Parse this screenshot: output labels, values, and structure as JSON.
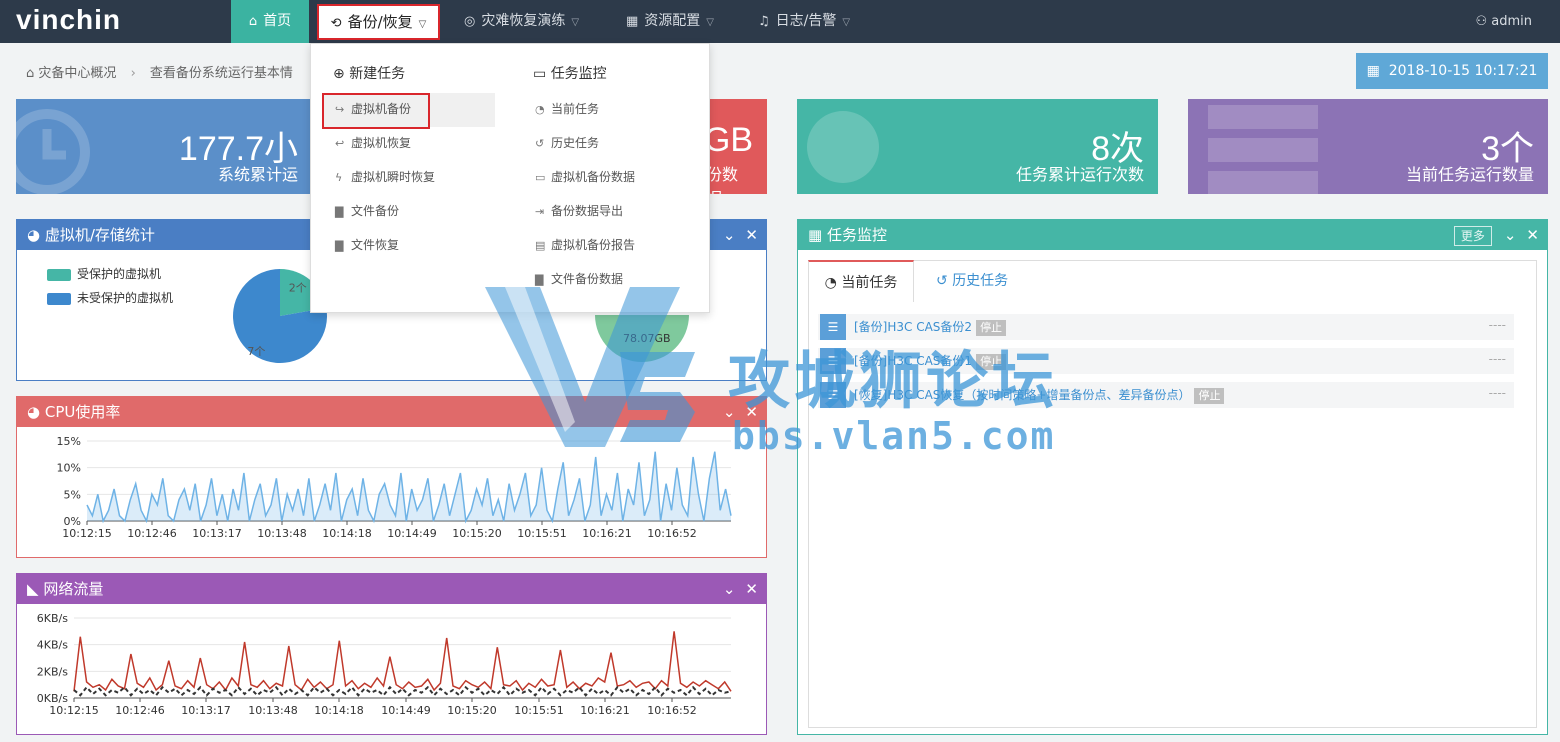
{
  "nav": {
    "logo": "vinchin",
    "items": [
      {
        "label": "首页"
      },
      {
        "label": "备份/恢复"
      },
      {
        "label": "灾难恢复演练"
      },
      {
        "label": "资源配置"
      },
      {
        "label": "日志/告警"
      }
    ],
    "user": "admin"
  },
  "breadcrumb": {
    "home": "灾备中心概况",
    "current": "查看备份系统运行基本情"
  },
  "datetime": "2018-10-15 10:17:21",
  "stats": [
    {
      "value": "177.7小",
      "label": "系统累计运"
    },
    {
      "value": "GB",
      "label": "份数据"
    },
    {
      "value": "8次",
      "label": "任务累计运行次数"
    },
    {
      "value": "3个",
      "label": "当前任务运行数量"
    }
  ],
  "dropdown": {
    "col1_title": "新建任务",
    "col1_items": [
      "虚拟机备份",
      "虚拟机恢复",
      "虚拟机瞬时恢复",
      "文件备份",
      "文件恢复"
    ],
    "col2_title": "任务监控",
    "col2_items": [
      "当前任务",
      "历史任务",
      "虚拟机备份数据",
      "备份数据导出",
      "虚拟机备份报告",
      "文件备份数据"
    ]
  },
  "panels": {
    "vm_title": "虚拟机/存储统计",
    "cpu_title": "CPU使用率",
    "net_title": "网络流量",
    "task_title": "任务监控",
    "task_more": "更多"
  },
  "vm_legend": [
    "受保护的虚拟机",
    "未受保护的虚拟机"
  ],
  "pie_labels": {
    "protected": "2个",
    "unprotected": "7个",
    "storage": "78.07GB"
  },
  "task_tabs": {
    "current": "当前任务",
    "history": "历史任务"
  },
  "tasks": [
    {
      "name": "[备份]H3C CAS备份2",
      "status": "停止",
      "time": "----"
    },
    {
      "name": "[备份]H3C CAS备份1",
      "status": "停止",
      "time": "----"
    },
    {
      "name": "[恢复]H3C CAS恢复（按时间策略+增量备份点、差异备份点）",
      "status": "停止",
      "time": "----"
    }
  ],
  "watermark": {
    "text": "攻城狮论坛",
    "url": "bbs.vlan5.com"
  },
  "colors": {
    "nav_bg": "#2d3a4a",
    "accent": "#3bb3a1",
    "blue": "#5b8fc9",
    "red": "#e0595b",
    "teal": "#45b6a6",
    "purple": "#8c73b5"
  },
  "chart_data": [
    {
      "type": "pie",
      "labels": [
        "受保护的虚拟机",
        "未受保护的虚拟机"
      ],
      "values": [
        2,
        7
      ]
    },
    {
      "type": "area",
      "title": "CPU使用率",
      "x": [
        "10:12:15",
        "10:12:46",
        "10:13:17",
        "10:13:48",
        "10:14:18",
        "10:14:49",
        "10:15:20",
        "10:15:51",
        "10:16:21",
        "10:16:52"
      ],
      "yticks": [
        "15%",
        "10%",
        "5%",
        "0%"
      ],
      "ylim": [
        0,
        15
      ],
      "series": [
        {
          "values": [
            3,
            1,
            5,
            0,
            2,
            6,
            1,
            0,
            4,
            7,
            2,
            0,
            5,
            3,
            8,
            1,
            0,
            4,
            6,
            2,
            7,
            0,
            3,
            8,
            1,
            5,
            0,
            6,
            2,
            9,
            0,
            4,
            7,
            1,
            3,
            8,
            0,
            5,
            2,
            6,
            1,
            8,
            0,
            3,
            7,
            2,
            9,
            0,
            4,
            6,
            1,
            8,
            2,
            0,
            5,
            7,
            3,
            1,
            9,
            0,
            6,
            2,
            4,
            8,
            0,
            3,
            7,
            1,
            5,
            9,
            0,
            2,
            6,
            3,
            8,
            1,
            4,
            0,
            7,
            2,
            5,
            9,
            1,
            3,
            10,
            2,
            0,
            6,
            11,
            1,
            4,
            8,
            0,
            3,
            12,
            1,
            5,
            2,
            9,
            0,
            6,
            3,
            11,
            1,
            4,
            13,
            0,
            7,
            2,
            10,
            3,
            1,
            12,
            5,
            0,
            8,
            13,
            2,
            6,
            1
          ]
        }
      ]
    },
    {
      "type": "line",
      "title": "网络流量",
      "x": [
        "10:12:15",
        "10:12:46",
        "10:13:17",
        "10:13:48",
        "10:14:18",
        "10:14:49",
        "10:15:20",
        "10:15:51",
        "10:16:21",
        "10:16:52"
      ],
      "yticks": [
        "6KB/s",
        "4KB/s",
        "2KB/s",
        "0KB/s"
      ],
      "ylim": [
        0,
        6
      ],
      "series": [
        {
          "values": [
            0.5,
            4.6,
            1.2,
            0.8,
            1.0,
            0.6,
            1.4,
            0.9,
            0.7,
            3.3,
            1.1,
            0.8,
            1.5,
            0.6,
            1.0,
            2.8,
            0.9,
            0.7,
            1.3,
            0.8,
            3.0,
            1.0,
            0.7,
            1.2,
            0.6,
            1.5,
            0.9,
            4.2,
            1.0,
            0.8,
            1.3,
            0.7,
            1.1,
            0.9,
            3.9,
            1.0,
            0.6,
            1.4,
            0.8,
            1.2,
            0.7,
            1.0,
            4.3,
            0.9,
            1.3,
            0.7,
            1.1,
            0.8,
            1.5,
            0.9,
            3.1,
            1.0,
            0.7,
            1.2,
            0.8,
            0.9,
            1.4,
            0.6,
            1.1,
            4.5,
            0.9,
            0.7,
            1.3,
            1.0,
            0.8,
            1.2,
            0.7,
            3.8,
            1.0,
            0.9,
            1.3,
            0.6,
            1.1,
            0.8,
            1.4,
            0.9,
            1.0,
            3.6,
            0.8,
            1.2,
            0.7,
            1.1,
            0.9,
            1.5,
            1.2,
            3.4,
            0.9,
            1.0,
            1.3,
            0.8,
            1.1,
            1.2,
            0.7,
            1.3,
            0.9,
            5.0,
            1.1,
            0.8,
            1.2,
            0.9,
            1.3,
            1.0,
            0.7,
            1.2,
            0.5
          ]
        },
        {
          "values": [
            0.6,
            0.2,
            0.8,
            0.3,
            0.7,
            0.2,
            0.6,
            0.4,
            0.8,
            0.2,
            0.7,
            0.3,
            0.6,
            0.2,
            0.8,
            0.4,
            0.7,
            0.2,
            0.6,
            0.3,
            0.8,
            0.2,
            0.7,
            0.4,
            0.6,
            0.2,
            0.8,
            0.3,
            0.7,
            0.2,
            0.6,
            0.4,
            0.8,
            0.2,
            0.7,
            0.3,
            0.6,
            0.2,
            0.8,
            0.4,
            0.7,
            0.2,
            0.6,
            0.3,
            0.8,
            0.2,
            0.7,
            0.4,
            0.6,
            0.2,
            0.8,
            0.3,
            0.7,
            0.2,
            0.6,
            0.4,
            0.8,
            0.2,
            0.7,
            0.3,
            0.6,
            0.2,
            0.8,
            0.4,
            0.7,
            0.2,
            0.6,
            0.3,
            0.8,
            0.2,
            0.7,
            0.4,
            0.6,
            0.2,
            0.8,
            0.3,
            0.7,
            0.2,
            0.6,
            0.4,
            0.8,
            0.2,
            0.7,
            0.3,
            0.6,
            0.2,
            0.8,
            0.4,
            0.7,
            0.2,
            0.6,
            0.3,
            0.8,
            0.2,
            0.7,
            0.4,
            0.6,
            0.2,
            0.8,
            0.3,
            0.7,
            0.2,
            0.6,
            0.4,
            0.5
          ]
        }
      ]
    }
  ]
}
